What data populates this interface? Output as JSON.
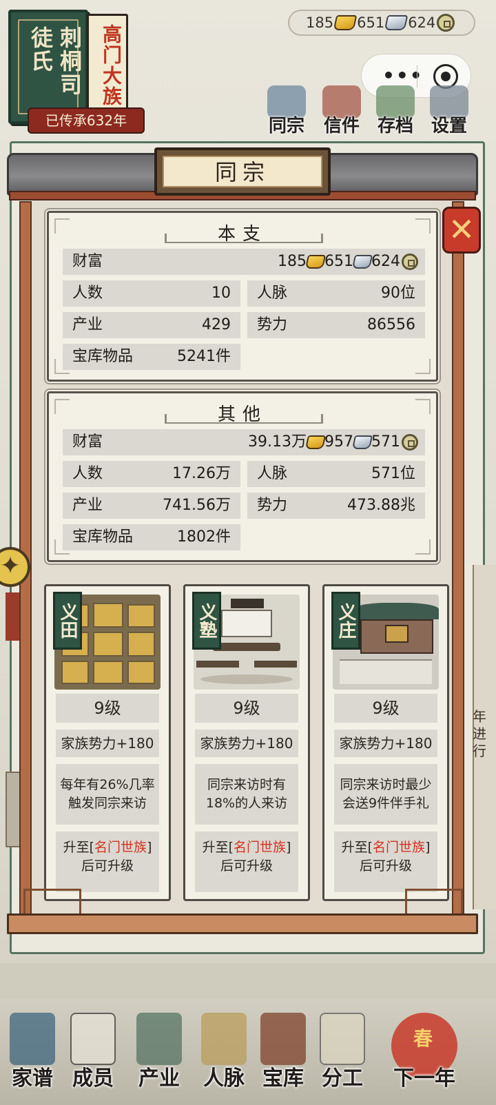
{
  "clan": {
    "name": "刺桐司徒氏",
    "rank": "高门大族",
    "inherit": "已传承632年"
  },
  "resources": {
    "gold": "185",
    "silver": "651",
    "coin": "624"
  },
  "top_nav": [
    "同宗",
    "信件",
    "存档",
    "设置"
  ],
  "panel": {
    "title": "同宗",
    "close_icon": "close-x-icon"
  },
  "main_branch": {
    "title": "本支",
    "wealth_label": "财富",
    "wealth_gold": "185",
    "wealth_silver": "651",
    "wealth_coin": "624",
    "people_label": "人数",
    "people": "10",
    "network_label": "人脉",
    "network": "90位",
    "industry_label": "产业",
    "industry": "429",
    "power_label": "势力",
    "power": "86556",
    "vault_label": "宝库物品",
    "vault": "5241件"
  },
  "other_branches": {
    "title": "其他",
    "wealth_label": "财富",
    "wealth_gold": "39.13万",
    "wealth_silver": "957",
    "wealth_coin": "571",
    "people_label": "人数",
    "people": "17.26万",
    "network_label": "人脉",
    "network": "571位",
    "industry_label": "产业",
    "industry": "741.56万",
    "power_label": "势力",
    "power": "473.88兆",
    "vault_label": "宝库物品",
    "vault": "1802件"
  },
  "facilities": [
    {
      "tag": "义田",
      "level": "9级",
      "bonus": "家族势力+180",
      "desc": "每年有26%几率触发同宗来访",
      "req_prefix": "升至[",
      "req_highlight": "名门世族",
      "req_suffix": "]后可升级"
    },
    {
      "tag": "义塾",
      "level": "9级",
      "bonus": "家族势力+180",
      "desc": "同宗来访时有18%的人来访",
      "req_prefix": "升至[",
      "req_highlight": "名门世族",
      "req_suffix": "]后可升级"
    },
    {
      "tag": "义庄",
      "level": "9级",
      "bonus": "家族势力+180",
      "desc": "同宗来访时最少会送9件伴手礼",
      "req_prefix": "升至[",
      "req_highlight": "名门世族",
      "req_suffix": "]后可升级"
    }
  ],
  "bottom_nav": [
    "家谱",
    "成员",
    "产业",
    "人脉",
    "宝库",
    "分工",
    "下一年"
  ],
  "next_year_badge": "春",
  "side_text": "年进行"
}
